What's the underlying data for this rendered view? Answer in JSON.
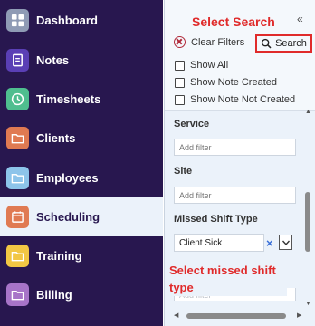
{
  "sidebar": {
    "items": [
      {
        "label": "Dashboard",
        "icon": "dashboard-icon",
        "color": "#8f9bb5"
      },
      {
        "label": "Notes",
        "icon": "notes-icon",
        "color": "#5a3fb5"
      },
      {
        "label": "Timesheets",
        "icon": "clock-icon",
        "color": "#4fbe8f"
      },
      {
        "label": "Clients",
        "icon": "folder-icon",
        "color": "#e07a52"
      },
      {
        "label": "Employees",
        "icon": "folder-icon",
        "color": "#8dc4ea"
      },
      {
        "label": "Scheduling",
        "icon": "calendar-icon",
        "color": "#e07a52"
      },
      {
        "label": "Training",
        "icon": "folder-icon",
        "color": "#f2c744"
      },
      {
        "label": "Billing",
        "icon": "folder-icon",
        "color": "#a774c8"
      }
    ],
    "active_item": "Scheduling"
  },
  "filter_panel": {
    "collapse_glyph": "«",
    "callout_title": "Select Search",
    "clear_filters_label": "Clear Filters",
    "search_label": "Search",
    "checkboxes": [
      {
        "label": "Show All",
        "checked": false
      },
      {
        "label": "Show Note Created",
        "checked": false
      },
      {
        "label": "Show Note Not Created",
        "checked": false
      }
    ],
    "fields": {
      "service": {
        "label": "Service",
        "placeholder": "Add filter"
      },
      "site": {
        "label": "Site",
        "placeholder": "Add filter"
      },
      "missed_shift_type": {
        "label": "Missed Shift Type",
        "value": "Client Sick",
        "clear_glyph": "×"
      }
    },
    "callout_missed_shift": "Select missed shift type",
    "partial_placeholder": "Add filter"
  },
  "colors": {
    "sidebar_bg": "#28174f",
    "active_bg": "#ebf2fa",
    "callout_red": "#e02b2b",
    "panel_bg": "#ebf2fa"
  }
}
